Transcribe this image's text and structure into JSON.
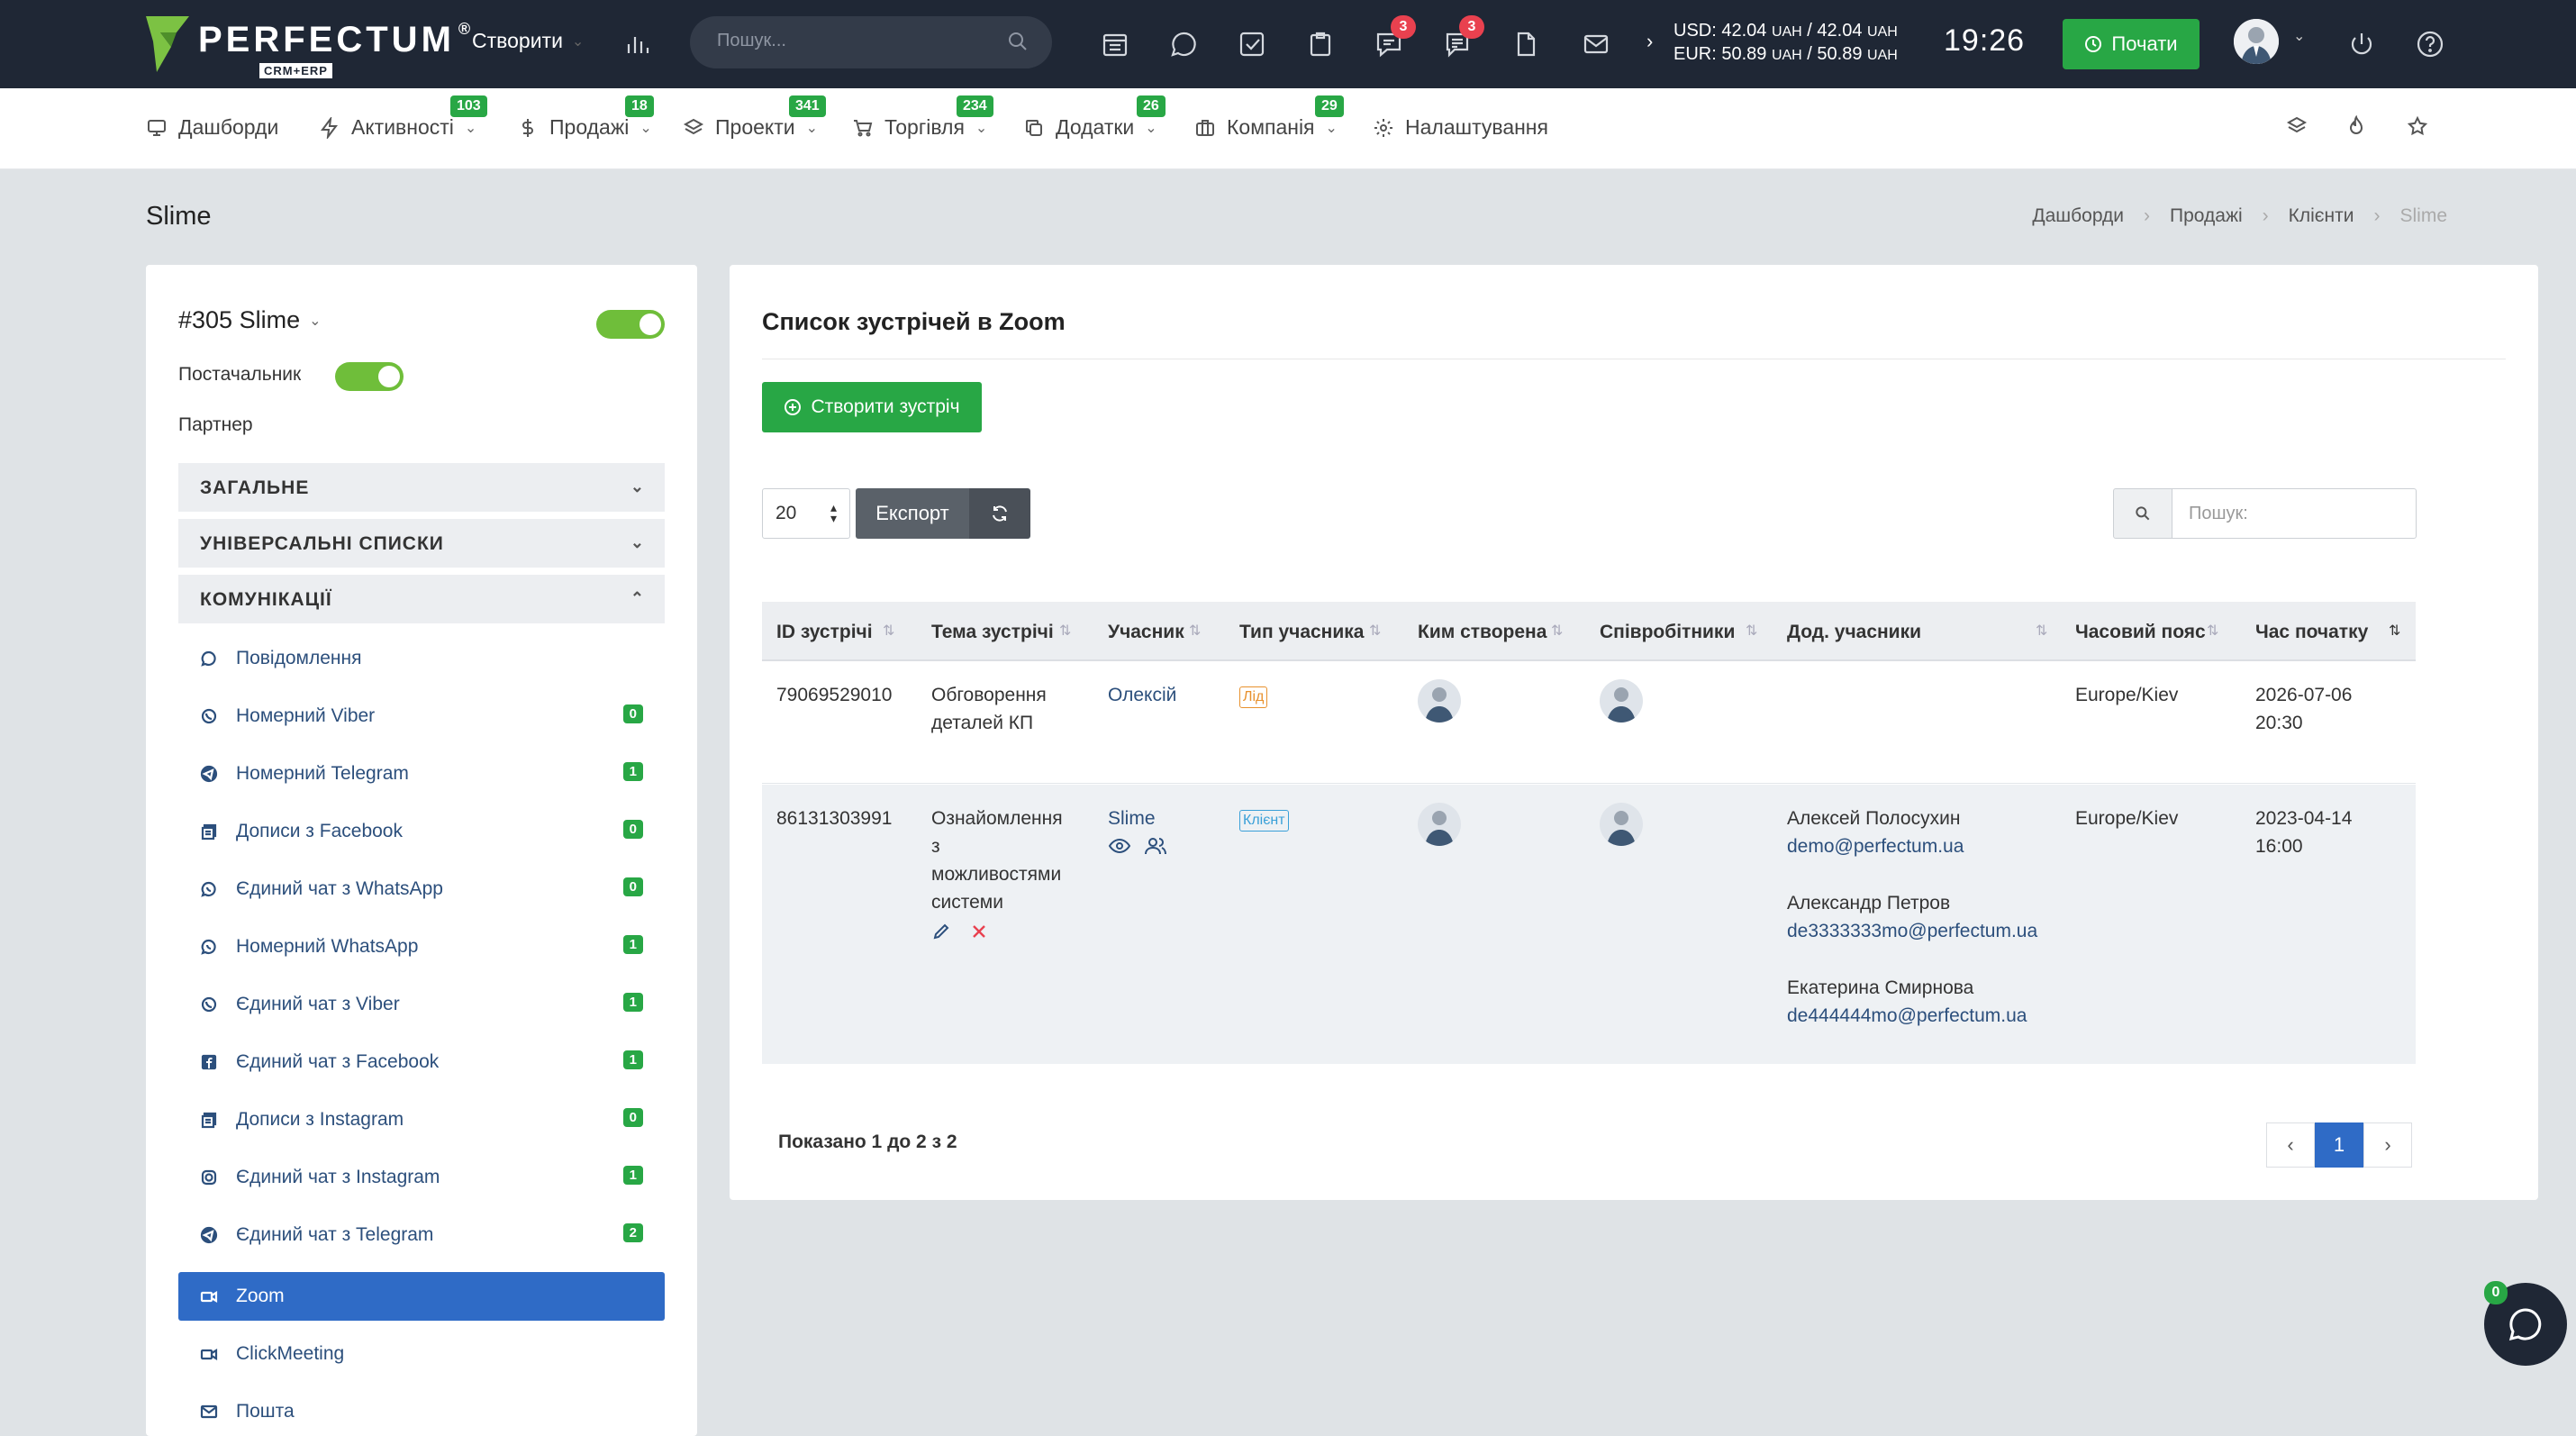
{
  "topbar": {
    "logo_text": "PERFECTUM",
    "logo_sub": "CRM+ERP",
    "create_label": "Створити",
    "search_placeholder": "Пошук...",
    "badges": {
      "messages": "3",
      "chat": "3"
    },
    "rates": {
      "usd": "USD: 42.04",
      "usd_unit1": "UAH",
      "usd_mid": " / 42.04 ",
      "usd_unit2": "UAH",
      "eur": "EUR: 50.89",
      "eur_unit1": "UAH",
      "eur_mid": " / 50.89 ",
      "eur_unit2": "UAH"
    },
    "time": "19:26",
    "start_label": "Почати"
  },
  "nav": {
    "items": [
      {
        "label": "Дашборди",
        "icon": "monitor-icon",
        "badge": ""
      },
      {
        "label": "Активності",
        "icon": "bolt-icon",
        "badge": "103"
      },
      {
        "label": "Продажі",
        "icon": "dollar-icon",
        "badge": "18"
      },
      {
        "label": "Проекти",
        "icon": "layers-icon",
        "badge": "341"
      },
      {
        "label": "Торгівля",
        "icon": "cart-icon",
        "badge": "234"
      },
      {
        "label": "Додатки",
        "icon": "copy-icon",
        "badge": "26"
      },
      {
        "label": "Компанія",
        "icon": "briefcase-icon",
        "badge": "29"
      },
      {
        "label": "Налаштування",
        "icon": "gear-icon",
        "badge": ""
      }
    ]
  },
  "page": {
    "title": "Slime",
    "breadcrumbs": [
      "Дашборди",
      "Продажі",
      "Клієнти",
      "Slime"
    ]
  },
  "left": {
    "client": "#305 Slime",
    "supplier_label": "Постачальник",
    "partner_label": "Партнер",
    "sections": [
      "ЗАГАЛЬНЕ",
      "УНІВЕРСАЛЬНІ СПИСКИ",
      "КОМУНІКАЦІЇ"
    ],
    "items": [
      {
        "label": "Повідомлення",
        "icon": "chat-icon",
        "count": ""
      },
      {
        "label": "Номерний Viber",
        "icon": "viber-icon",
        "count": "0"
      },
      {
        "label": "Номерний Telegram",
        "icon": "telegram-icon",
        "count": "1"
      },
      {
        "label": "Дописи з Facebook",
        "icon": "posts-icon",
        "count": "0"
      },
      {
        "label": "Єдиний чат з WhatsApp",
        "icon": "whatsapp-icon",
        "count": "0"
      },
      {
        "label": "Номерний WhatsApp",
        "icon": "whatsapp-icon",
        "count": "1"
      },
      {
        "label": "Єдиний чат з Viber",
        "icon": "viber-icon",
        "count": "1"
      },
      {
        "label": "Єдиний чат з Facebook",
        "icon": "facebook-icon",
        "count": "1"
      },
      {
        "label": "Дописи з Instagram",
        "icon": "posts-icon",
        "count": "0"
      },
      {
        "label": "Єдиний чат з Instagram",
        "icon": "instagram-icon",
        "count": "1"
      },
      {
        "label": "Єдиний чат з Telegram",
        "icon": "telegram-icon",
        "count": "2"
      },
      {
        "label": "Zoom",
        "icon": "video-icon",
        "count": ""
      },
      {
        "label": "ClickMeeting",
        "icon": "video-icon",
        "count": ""
      },
      {
        "label": "Пошта",
        "icon": "mail-icon",
        "count": ""
      }
    ]
  },
  "main": {
    "title": "Список зустрічей в Zoom",
    "create_btn": "Створити зустріч",
    "page_size": "20",
    "export_label": "Експорт",
    "search_placeholder": "Пошук:",
    "columns": [
      "ID зустрічі",
      "Тема зустрічі",
      "Учасник",
      "Тип учасника",
      "Ким створена",
      "Співробітники",
      "Дод. учасники",
      "Часовий пояс",
      "Час початку"
    ],
    "rows": [
      {
        "id": "79069529010",
        "topic": [
          "Обговорення",
          "деталей КП"
        ],
        "participant": "Олексій",
        "type": "Лід",
        "timezone": "Europe/Kiev",
        "start_date": "2026-07-06",
        "start_time": "20:30",
        "extra": []
      },
      {
        "id": "86131303991",
        "topic": [
          "Ознайомлення",
          "з",
          "можливостями",
          "системи"
        ],
        "participant": "Slime",
        "type": "Клієнт",
        "timezone": "Europe/Kiev",
        "start_date": "2023-04-14",
        "start_time": "16:00",
        "extra": [
          {
            "name": "Алексей Полосухин",
            "email": "demo@perfectum.ua"
          },
          {
            "name": "Александр Петров",
            "email": "de3333333mo@perfectum.ua"
          },
          {
            "name": "Екатерина Смирнова",
            "email": "de444444mo@perfectum.ua"
          }
        ]
      }
    ],
    "showing": "Показано 1 до 2 з 2",
    "current_page": "1"
  },
  "chat_widget": {
    "badge": "0"
  },
  "colors": {
    "accent_green": "#28a745",
    "accent_blue": "#2f6bc6",
    "topbar": "#1f2735",
    "lead_tag": "#e8912d",
    "client_tag": "#3aa0d8"
  }
}
